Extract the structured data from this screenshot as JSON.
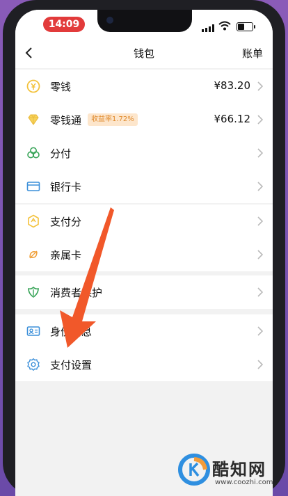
{
  "status": {
    "time": "14:09"
  },
  "nav": {
    "title": "钱包",
    "right_label": "账单"
  },
  "groups": [
    {
      "items": [
        {
          "label": "零钱",
          "value": "¥83.20",
          "icon": "coin-icon"
        },
        {
          "label": "零钱通",
          "badge": "收益率1.72%",
          "value": "¥66.12",
          "icon": "diamond-icon"
        },
        {
          "label": "分付",
          "icon": "flower-icon"
        },
        {
          "label": "银行卡",
          "icon": "bank-card-icon"
        }
      ]
    },
    {
      "items": [
        {
          "label": "支付分",
          "icon": "score-icon"
        },
        {
          "label": "亲属卡",
          "icon": "family-card-icon"
        }
      ]
    },
    {
      "items": [
        {
          "label": "消费者保护",
          "icon": "shield-leaf-icon"
        }
      ]
    },
    {
      "items": [
        {
          "label": "身份信息",
          "icon": "id-card-icon"
        },
        {
          "label": "支付设置",
          "icon": "gear-icon"
        }
      ]
    }
  ],
  "colors": {
    "accent_green": "#3aa55a",
    "badge_bg": "#fde6cc",
    "badge_text": "#e08a2c",
    "arrow": "#f1582a",
    "coin": "#f3c23c"
  },
  "watermark": {
    "title": "酷知网",
    "url": "www.coozhi.com"
  }
}
